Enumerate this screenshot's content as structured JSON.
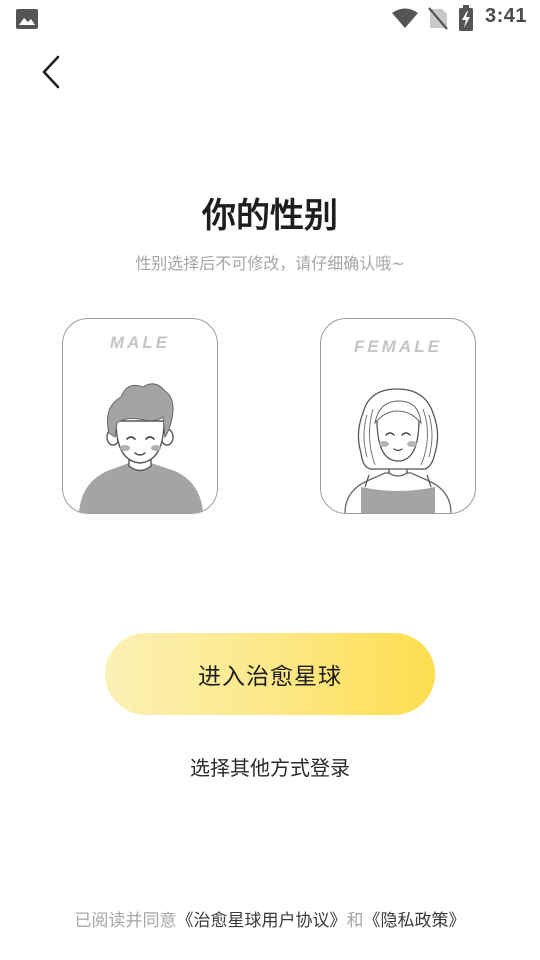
{
  "status_bar": {
    "time": "3:41",
    "icons": [
      "image-icon",
      "wifi-icon",
      "no-sim-icon",
      "battery-charging-icon"
    ]
  },
  "header": {
    "back_icon": "chevron-left-icon"
  },
  "main": {
    "title": "你的性别",
    "subtitle": "性别选择后不可修改，请仔细确认哦~",
    "options": [
      {
        "label": "MALE"
      },
      {
        "label": "FEMALE"
      }
    ],
    "primary_button": "进入治愈星球",
    "other_login": "选择其他方式登录"
  },
  "footer": {
    "agreement_prefix": "已阅读并同意",
    "user_agreement": "《治愈星球用户协议》",
    "conjunction": "和",
    "privacy_policy": "《隐私政策》"
  },
  "colors": {
    "button_gradient_start": "#fbf1b6",
    "button_gradient_end": "#fddd4e",
    "title": "#1e1e1e",
    "muted": "#a6a6a6",
    "card_border": "#9c9c9c"
  }
}
